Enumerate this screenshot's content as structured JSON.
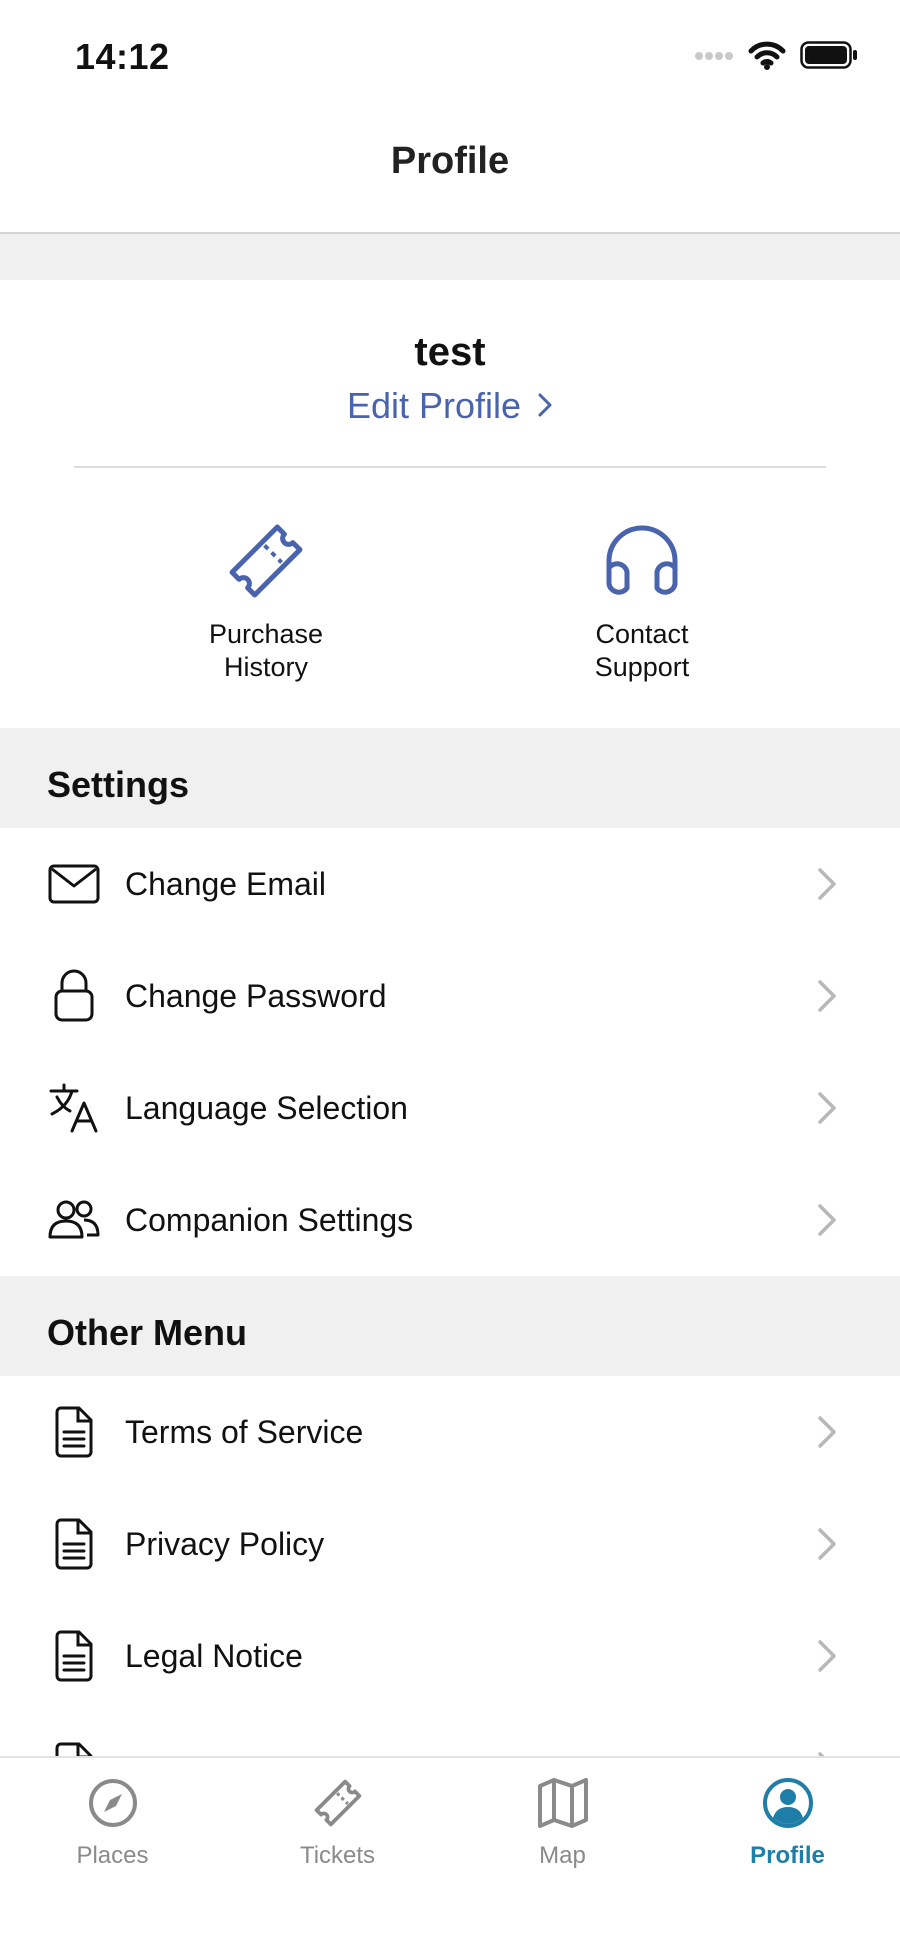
{
  "status_bar": {
    "time": "14:12",
    "icons": [
      "signal-icon",
      "wifi-icon",
      "battery-icon"
    ]
  },
  "header": {
    "title": "Profile"
  },
  "profile": {
    "username": "test",
    "edit_label": "Edit Profile"
  },
  "quick_actions": [
    {
      "label": "Purchase\nHistory",
      "icon": "ticket-icon"
    },
    {
      "label": "Contact\nSupport",
      "icon": "headphones-icon"
    }
  ],
  "settings": {
    "title": "Settings",
    "items": [
      {
        "label": "Change Email",
        "icon": "envelope-icon"
      },
      {
        "label": "Change Password",
        "icon": "lock-icon"
      },
      {
        "label": "Language Selection",
        "icon": "translate-icon"
      },
      {
        "label": "Companion Settings",
        "icon": "people-icon"
      }
    ]
  },
  "other_menu": {
    "title": "Other Menu",
    "items": [
      {
        "label": "Terms of Service",
        "icon": "document-icon"
      },
      {
        "label": "Privacy Policy",
        "icon": "document-icon"
      },
      {
        "label": "Legal Notice",
        "icon": "document-icon"
      }
    ]
  },
  "tab_bar": {
    "tabs": [
      {
        "label": "Places",
        "icon": "compass-icon",
        "active": false
      },
      {
        "label": "Tickets",
        "icon": "ticket-icon",
        "active": false
      },
      {
        "label": "Map",
        "icon": "map-icon",
        "active": false
      },
      {
        "label": "Profile",
        "icon": "person-circle-icon",
        "active": true
      }
    ]
  },
  "colors": {
    "accent": "#4a63ad",
    "tab_active": "#1e7ea8",
    "tab_inactive": "#8a8a8a",
    "section_bg": "#f0f0f0",
    "chevron": "#b8b8b8"
  }
}
